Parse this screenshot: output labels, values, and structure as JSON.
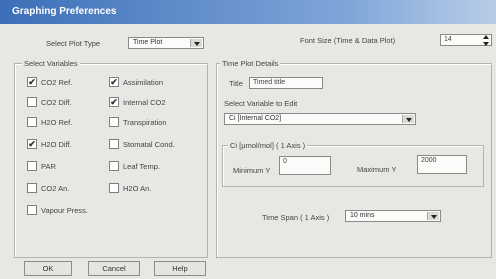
{
  "window": {
    "title": "Graphing Preferences"
  },
  "plot_type": {
    "label": "Select Plot Type",
    "value": "Time Plot"
  },
  "font_size": {
    "label": "Font Size (Time & Data Plot)",
    "value": "14"
  },
  "variables": {
    "group_label": "Select Variables",
    "items": [
      {
        "label": "CO2 Ref.",
        "checked": true,
        "mark": "✔"
      },
      {
        "label": "Assimilation",
        "checked": true,
        "mark": "✔"
      },
      {
        "label": "CO2 Diff.",
        "checked": false,
        "mark": ""
      },
      {
        "label": "Internal CO2",
        "checked": true,
        "mark": "✔"
      },
      {
        "label": "H2O Ref.",
        "checked": false,
        "mark": ""
      },
      {
        "label": "Transpiration",
        "checked": false,
        "mark": ""
      },
      {
        "label": "H2O Diff.",
        "checked": true,
        "mark": "✔"
      },
      {
        "label": "Stomatal Cond.",
        "checked": false,
        "mark": ""
      },
      {
        "label": "PAR",
        "checked": false,
        "mark": ""
      },
      {
        "label": "Leaf Temp.",
        "checked": false,
        "mark": ""
      },
      {
        "label": "CO2 An.",
        "checked": false,
        "mark": ""
      },
      {
        "label": "H2O An.",
        "checked": false,
        "mark": ""
      },
      {
        "label": "Vapour Press.",
        "checked": false,
        "mark": ""
      }
    ]
  },
  "time_plot": {
    "group_label": "Time Plot Details",
    "title_label": "Title",
    "title_value": "Timed title",
    "select_var_label": "Select Variable to Edit",
    "select_var_value": "Ci [Internal CO2]",
    "range_group_label": "Ci [µmol/mol] ( 1 Axis )",
    "min_label": "Minimum Y",
    "min_value": "0",
    "max_label": "Maximum Y",
    "max_value": "2000",
    "time_span_label": "Time Span ( 1 Axis )",
    "time_span_value": "10 mins"
  },
  "buttons": {
    "ok": "OK",
    "cancel": "Cancel",
    "help": "Help"
  }
}
